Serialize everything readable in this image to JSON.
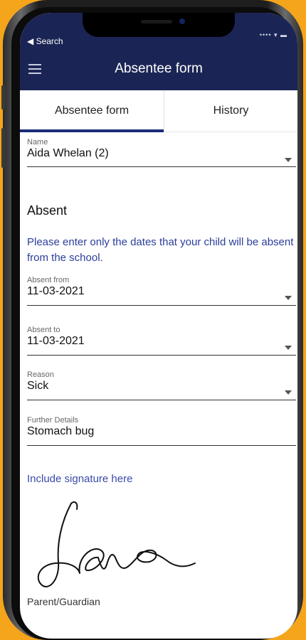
{
  "status_bar": {
    "back_label": "◀ Search",
    "indicators": "•••• ▾ ▬"
  },
  "header": {
    "title": "Absentee form",
    "menu_icon": "hamburger-icon"
  },
  "tabs": [
    {
      "label": "Absentee form",
      "active": true
    },
    {
      "label": "History",
      "active": false
    }
  ],
  "form": {
    "name": {
      "label": "Name",
      "value": "Aida Whelan (2)"
    },
    "section_title": "Absent",
    "instruction": "Please enter only the dates that your child will be absent from the school.",
    "absent_from": {
      "label": "Absent from",
      "value": "11-03-2021"
    },
    "absent_to": {
      "label": "Absent to",
      "value": "11-03-2021"
    },
    "reason": {
      "label": "Reason",
      "value": "Sick"
    },
    "further_details": {
      "label": "Further Details",
      "value": "Stomach bug"
    },
    "signature_label": "Include signature here",
    "signature_name": "Jane",
    "parent_label": "Parent/Guardian"
  },
  "colors": {
    "header_bg": "#1b2555",
    "accent": "#1b2d78",
    "link_text": "#2b3d9a",
    "page_bg": "#f4a51c"
  }
}
